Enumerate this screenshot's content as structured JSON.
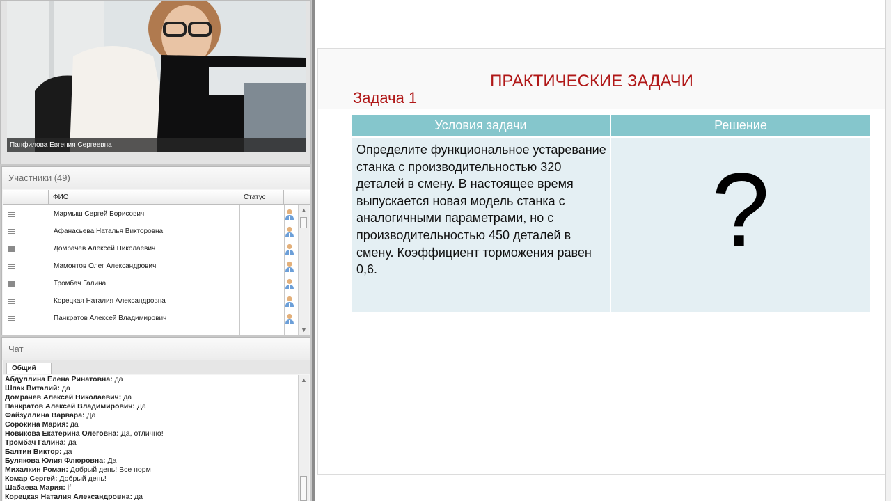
{
  "video": {
    "caption": "Панфилова Евгения Сергеевна"
  },
  "participants": {
    "title": "Участники (49)",
    "columns": [
      "ФИО",
      "Статус"
    ],
    "rows": [
      "Мармыш Сергей Борисович",
      "Афанасьева Наталья Викторовна",
      "Домрачев Алексей Николаевич",
      "Мамонтов Олег Александрович",
      "Тромбач Галина",
      "Корецкая Наталия Александровна",
      "Панкратов Алексей Владимирович"
    ]
  },
  "chat": {
    "title": "Чат",
    "tab": "Общий",
    "messages": [
      {
        "author": "Абдуллина Елена Ринатовна:",
        "text": " да"
      },
      {
        "author": "Шпак Виталий:",
        "text": " да"
      },
      {
        "author": "Домрачев Алексей Николаевич:",
        "text": " да"
      },
      {
        "author": "Панкратов Алексей Владимирович:",
        "text": " Да"
      },
      {
        "author": "Файзуллина Варвара:",
        "text": " Да"
      },
      {
        "author": "Сорокина Мария:",
        "text": " да"
      },
      {
        "author": "Новикова Екатерина Олеговна:",
        "text": " Да, отлично!"
      },
      {
        "author": "Тромбач Галина:",
        "text": " да"
      },
      {
        "author": "Балтин Виктор:",
        "text": " да"
      },
      {
        "author": "Булякова Юлия Флюровна:",
        "text": " Да"
      },
      {
        "author": "Михалкин Роман:",
        "text": " Добрый день! Все норм"
      },
      {
        "author": "Комар Сергей:",
        "text": " Добрый день!"
      },
      {
        "author": "Шабаева Мария:",
        "text": " lf"
      },
      {
        "author": "Корецкая Наталия Александровна:",
        "text": " да"
      }
    ]
  },
  "slide": {
    "title": "ПРАКТИЧЕСКИЕ ЗАДАЧИ",
    "task": "Задача 1",
    "col_conditions": "Условия задачи",
    "col_solution": "Решение",
    "conditions": "Определите функциональное устаревание станка с производительностью 320 деталей в смену. В настоящее время выпускается новая модель станка с аналогичными параметрами, но с производительностью 450 деталей  в смену. Коэффициент торможения равен 0,6.",
    "solution": "?"
  },
  "colors": {
    "title_red": "#b01818",
    "header_teal": "#85c6cc",
    "cell_bg": "#e4eff3"
  }
}
